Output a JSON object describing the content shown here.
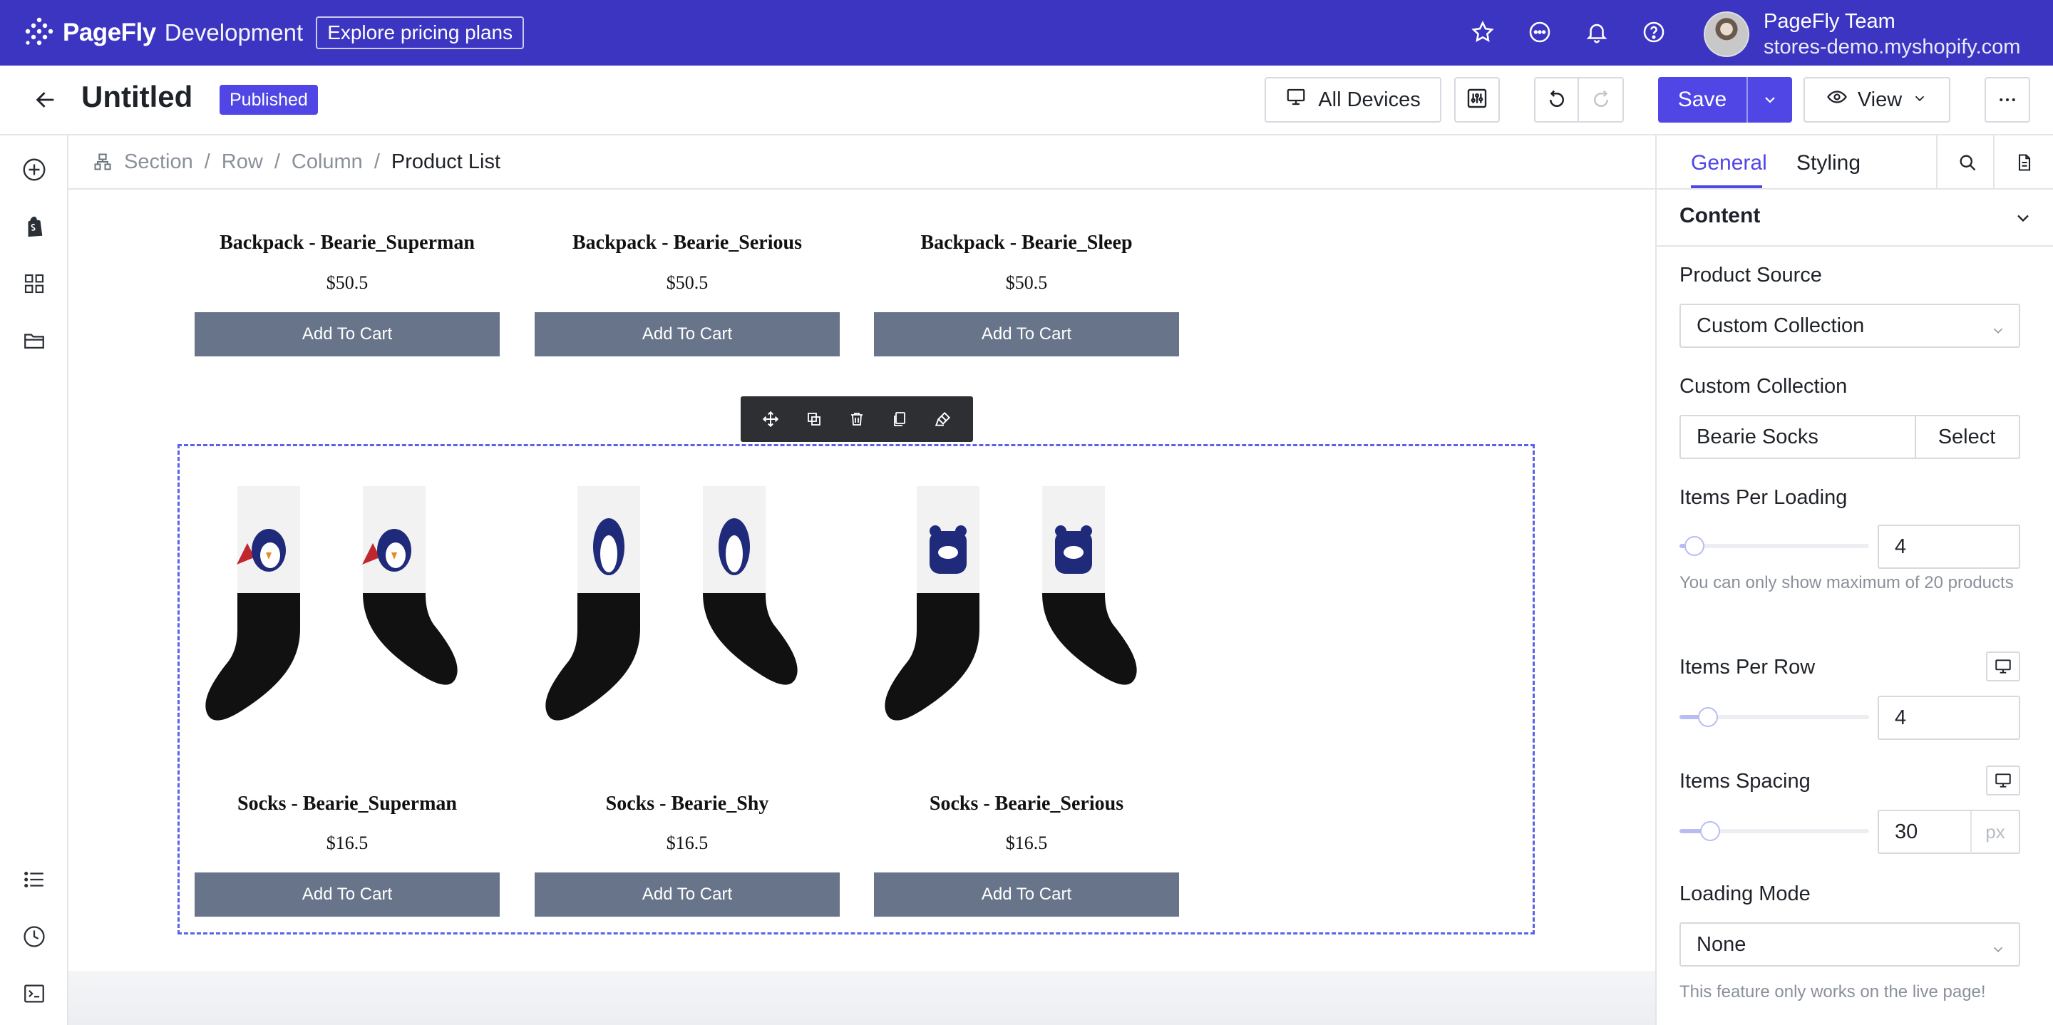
{
  "topbar": {
    "brand_name": "PageFly",
    "brand_env": "Development",
    "pricing_label": "Explore pricing plans",
    "user_name": "PageFly Team",
    "user_store": "stores-demo.myshopify.com"
  },
  "header": {
    "title": "Untitled",
    "status": "Published",
    "devices_label": "All Devices",
    "save_label": "Save",
    "view_label": "View"
  },
  "breadcrumb": [
    "Section",
    "Row",
    "Column",
    "Product List"
  ],
  "products_top": [
    {
      "name": "Backpack - Bearie_Superman",
      "price": "$50.5",
      "button": "Add To Cart"
    },
    {
      "name": "Backpack - Bearie_Serious",
      "price": "$50.5",
      "button": "Add To Cart"
    },
    {
      "name": "Backpack - Bearie_Sleep",
      "price": "$50.5",
      "button": "Add To Cart"
    }
  ],
  "products_selected": [
    {
      "name": "Socks - Bearie_Superman",
      "price": "$16.5",
      "button": "Add To Cart",
      "image": "socks-superman"
    },
    {
      "name": "Socks - Bearie_Shy",
      "price": "$16.5",
      "button": "Add To Cart",
      "image": "socks-shy"
    },
    {
      "name": "Socks - Bearie_Serious",
      "price": "$16.5",
      "button": "Add To Cart",
      "image": "socks-serious"
    }
  ],
  "panel": {
    "tabs": [
      "General",
      "Styling"
    ],
    "active_tab": "General",
    "section_title": "Content",
    "product_source_label": "Product Source",
    "product_source_value": "Custom Collection",
    "custom_collection_label": "Custom Collection",
    "custom_collection_value": "Bearie Socks",
    "select_label": "Select",
    "items_per_loading_label": "Items Per Loading",
    "items_per_loading_value": "4",
    "items_per_loading_help": "You can only show maximum of 20 products",
    "items_per_row_label": "Items Per Row",
    "items_per_row_value": "4",
    "items_spacing_label": "Items Spacing",
    "items_spacing_value": "30",
    "items_spacing_unit": "px",
    "loading_mode_label": "Loading Mode",
    "loading_mode_value": "None",
    "loading_mode_help": "This feature only works on the live page!",
    "sliders": {
      "items_per_loading": 0.08,
      "items_per_row": 0.15,
      "items_spacing": 0.16
    }
  },
  "colors": {
    "brand": "#3b35c2",
    "accent": "#4f46e5",
    "cart_button": "#677489",
    "selection": "#5b62e8"
  }
}
